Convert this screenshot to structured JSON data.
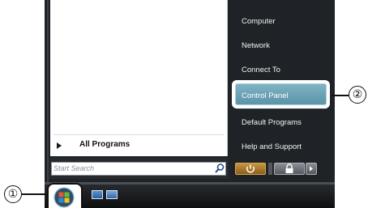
{
  "menu": {
    "left": {
      "all_programs": "All Programs",
      "search_placeholder": "Start Search"
    },
    "right": {
      "items": [
        "Computer",
        "Network",
        "Connect To",
        "Control Panel",
        "Default Programs",
        "Help and Support"
      ],
      "highlighted": "Control Panel"
    }
  },
  "callouts": {
    "one": "①",
    "two": "②"
  },
  "colors": {
    "menu_dark": "#1f2226",
    "highlight": "#6aa3b8",
    "power_button": "#b8842e"
  },
  "icons": [
    "arrow-right-icon",
    "search-icon",
    "power-icon",
    "lock-icon",
    "chevron-right-icon",
    "windows-start-orb-icon",
    "show-desktop-icon",
    "switch-windows-icon"
  ]
}
